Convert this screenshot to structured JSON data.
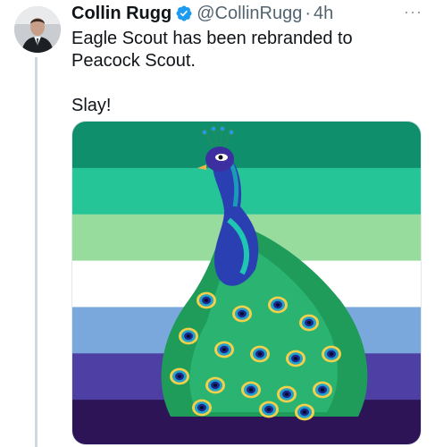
{
  "tweet": {
    "author_name": "Collin Rugg",
    "handle": "@CollinRugg",
    "separator": "·",
    "timestamp": "4h",
    "verified": true,
    "text_line1": "Eagle Scout has been rebranded to Peacock Scout.",
    "text_line2": "Slay!",
    "more_label": "···"
  },
  "media": {
    "description_icon": "peacock-illustration",
    "flag_stripes": [
      "#0f8f6b",
      "#26c598",
      "#98dc9d",
      "#ffffff",
      "#7ba8dc",
      "#4d3fa4",
      "#2c1457"
    ]
  },
  "colors": {
    "verified": "#1d9bf0",
    "thread_line": "#cfd9de",
    "secondary_text": "#536471"
  }
}
